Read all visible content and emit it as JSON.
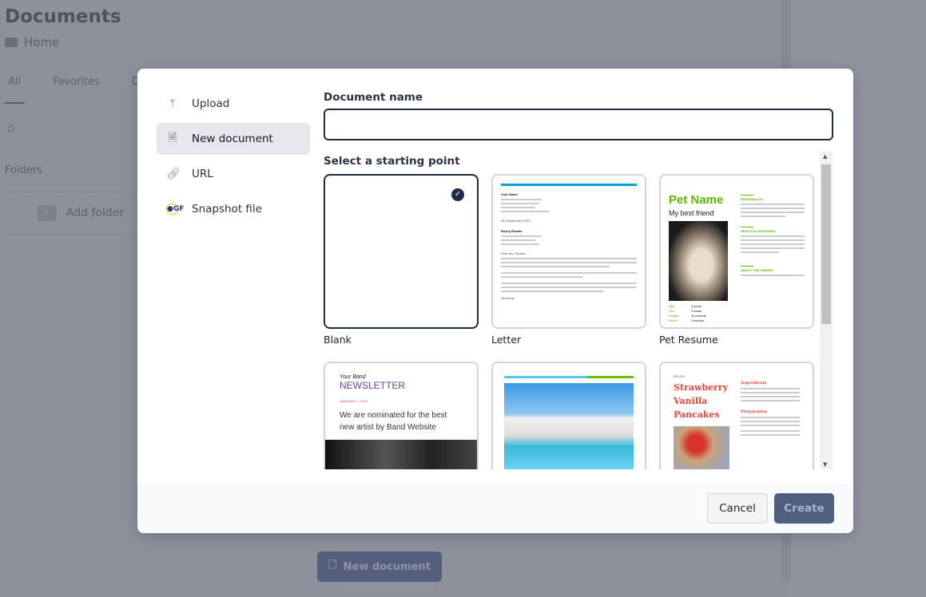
{
  "background": {
    "title": "Documents",
    "breadcrumb": "Home",
    "tabs": [
      "All",
      "Favorites",
      "D"
    ],
    "folders_label": "Folders",
    "add_folder": "Add folder",
    "new_document_button": "New document"
  },
  "dialog": {
    "sidebar": [
      {
        "label": "Upload",
        "icon": "upload-icon"
      },
      {
        "label": "New document",
        "icon": "new-document-icon",
        "active": true
      },
      {
        "label": "URL",
        "icon": "link-icon"
      },
      {
        "label": "Snapshot file",
        "icon": "gf-snapshot-icon"
      }
    ],
    "name_label": "Document name",
    "name_value": "",
    "start_label": "Select a starting point",
    "templates": [
      {
        "name": "Blank",
        "selected": true
      },
      {
        "name": "Letter",
        "preview": {
          "sender": "Your Name",
          "date": "4th September 20XX",
          "recipient": "Rosey Reader",
          "salutation": "Dear Ms. Reader,",
          "closing": "Sincerely,"
        }
      },
      {
        "name": "Pet Resume",
        "preview": {
          "title": "Pet Name",
          "subtitle": "My best friend",
          "sections": [
            "PERSONALITY",
            "HEALTH & GROOMING",
            "ABOUT THE OWNER"
          ],
          "facts": [
            [
              "Age:",
              "4 years"
            ],
            [
              "Sex:",
              "Female"
            ],
            [
              "Weight:",
              "10 pounds"
            ],
            [
              "Breed:",
              "Shorthair"
            ]
          ]
        }
      },
      {
        "name": "",
        "preview": {
          "kicker": "Your Band",
          "title": "NEWSLETTER",
          "date": "September 4, 20XX",
          "headline": "We are nominated for the best new artist by Band Website"
        }
      },
      {
        "name": "",
        "preview": {}
      },
      {
        "name": "",
        "preview": {
          "kicker": "RECIPE",
          "title": "Strawberry Vanilla Pancakes",
          "sections": [
            "Ingredients",
            "Preparation"
          ]
        }
      }
    ],
    "cancel": "Cancel",
    "create": "Create"
  },
  "colors": {
    "accent": "#1f2a44",
    "create_button": "#4f5f80",
    "pet_green": "#5cb800",
    "newsletter_purple": "#6b3fa0",
    "recipe_red": "#e8473b",
    "letter_blue": "#0aa0e0"
  }
}
